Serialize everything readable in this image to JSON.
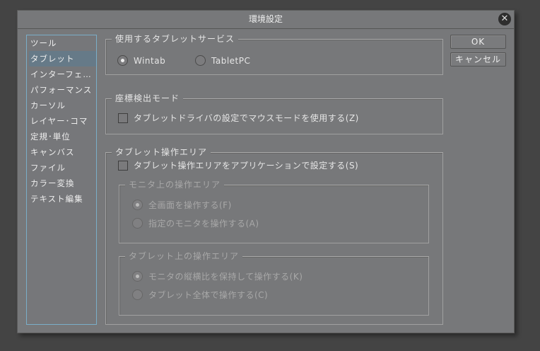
{
  "title": "環境設定",
  "sidebar": {
    "items": [
      "ツール",
      "タブレット",
      "インターフェ…",
      "パフォーマンス",
      "カーソル",
      "レイヤー･コマ",
      "定規･単位",
      "キャンバス",
      "ファイル",
      "カラー変換",
      "テキスト編集"
    ],
    "selected": "タブレット"
  },
  "buttons": {
    "ok": "OK",
    "cancel": "キャンセル"
  },
  "service": {
    "title": "使用するタブレットサービス",
    "options": [
      "Wintab",
      "TabletPC"
    ],
    "selected": "Wintab"
  },
  "coord": {
    "title": "座標検出モード",
    "checkbox": "タブレットドライバの設定でマウスモードを使用する(Z)",
    "checked": false
  },
  "area": {
    "title": "タブレット操作エリア",
    "checkbox": "タブレット操作エリアをアプリケーションで設定する(S)",
    "checked": false,
    "monitor": {
      "title": "モニタ上の操作エリア",
      "options": [
        "全画面を操作する(F)",
        "指定のモニタを操作する(A)"
      ],
      "selected": "全画面を操作する(F)"
    },
    "tablet": {
      "title": "タブレット上の操作エリア",
      "options": [
        "モニタの縦横比を保持して操作する(K)",
        "タブレット全体で操作する(C)"
      ],
      "selected": "モニタの縦横比を保持して操作する(K)"
    }
  }
}
